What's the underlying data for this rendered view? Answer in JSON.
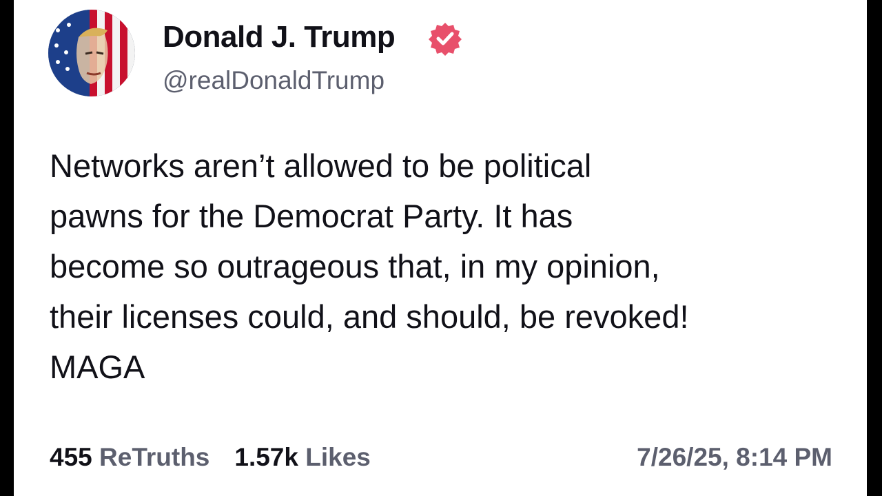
{
  "author": {
    "display_name": "Donald J. Trump",
    "handle": "@realDonaldTrump",
    "avatar_icon": "flag-portrait-avatar",
    "verified_icon": "verified-badge-icon",
    "verified_color": "#e8506b"
  },
  "post": {
    "lines": [
      "Networks aren’t allowed to be political",
      "pawns for the Democrat Party. It has",
      "become so outrageous that, in my opinion,",
      "their licenses could, and should, be revoked!",
      "MAGA"
    ]
  },
  "stats": {
    "retruths_count": "455",
    "retruths_label": "ReTruths",
    "likes_count": "1.57k",
    "likes_label": "Likes"
  },
  "timestamp": "7/26/25, 8:14 PM",
  "colors": {
    "text_primary": "#111118",
    "text_secondary": "#5c5f6e",
    "background": "#ffffff",
    "frame": "#000000"
  }
}
